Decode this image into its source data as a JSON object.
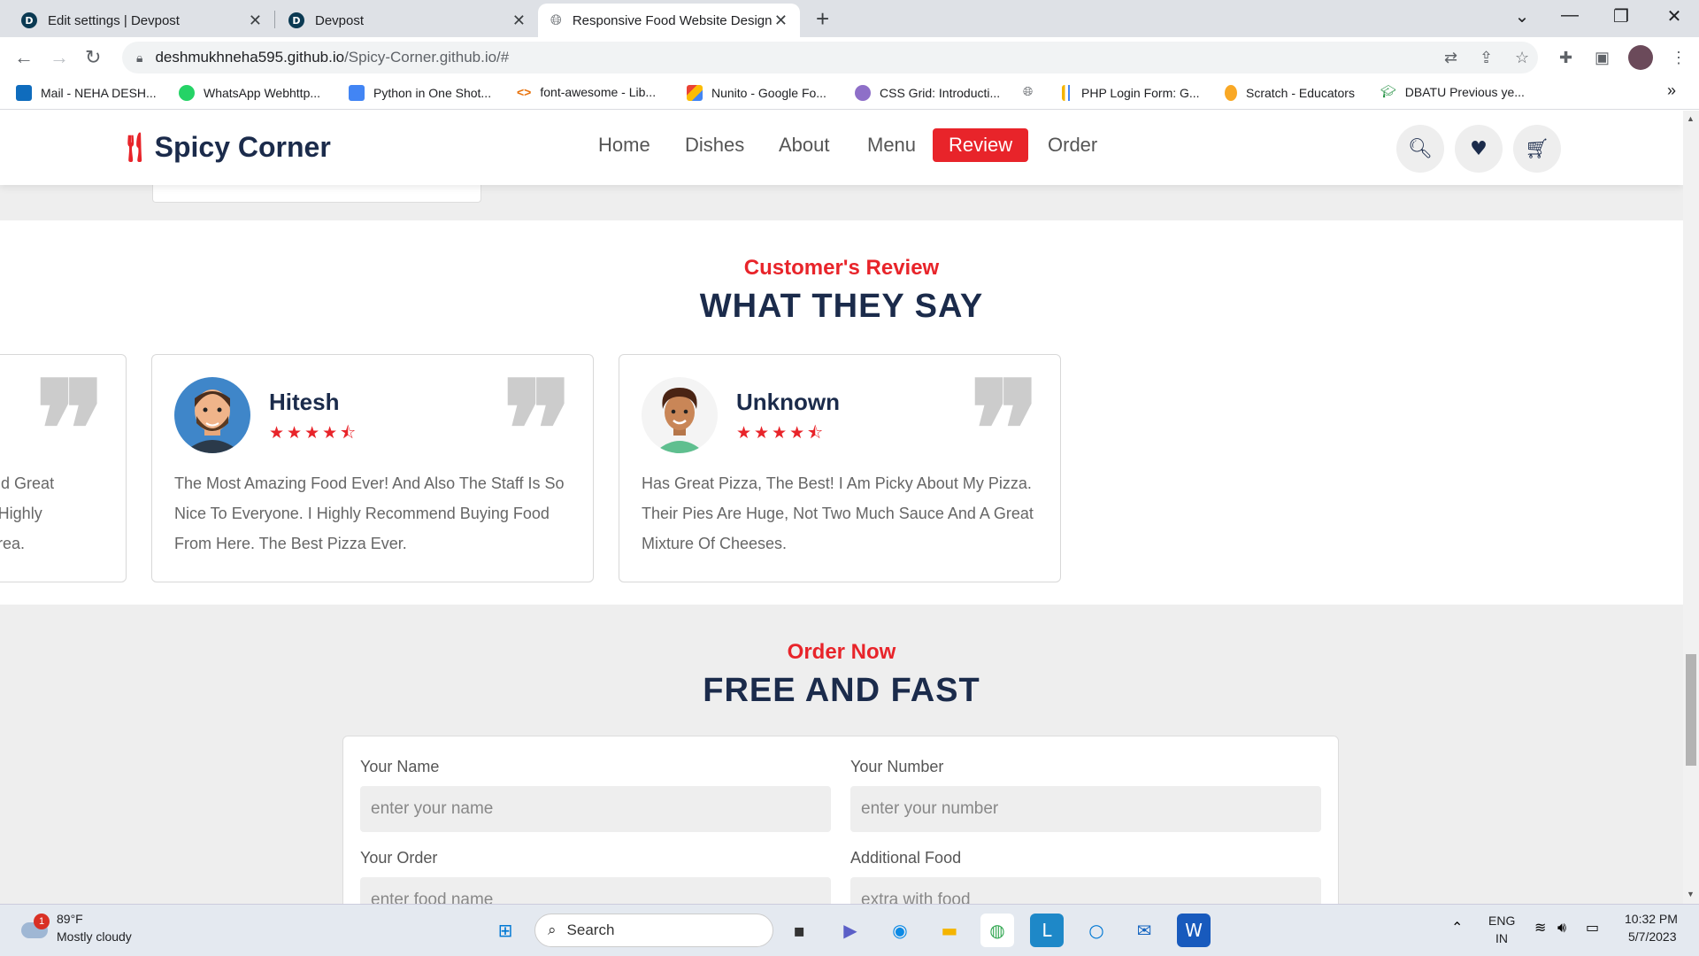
{
  "browser": {
    "tabs": [
      {
        "title": "Edit settings | Devpost",
        "favicon": "D",
        "active": false
      },
      {
        "title": "Devpost",
        "favicon": "D",
        "active": false
      },
      {
        "title": "Responsive Food Website Design",
        "favicon": "globe",
        "active": true
      }
    ],
    "new_tab": "+",
    "url_host": "deshmukhneha595.github.io",
    "url_path": "/Spicy-Corner.github.io/#",
    "bookmarks": [
      "Mail - NEHA DESH...",
      "WhatsApp Webhttp...",
      "Python in One Shot...",
      "font-awesome - Lib...",
      "Nunito - Google Fo...",
      "CSS Grid: Introducti...",
      "PHP Login Form: G...",
      "Scratch - Educators",
      "DBATU Previous ye..."
    ],
    "more_bookmarks": "»"
  },
  "site": {
    "logo": "Spicy Corner",
    "nav": [
      "Home",
      "Dishes",
      "About",
      "Menu",
      "Review",
      "Order"
    ],
    "active_nav": "Review",
    "accent_color": "#e8242a",
    "heading_color": "#1b2b4b"
  },
  "review": {
    "subheading": "Customer's Review",
    "heading": "WHAT THEY SAY",
    "partial_card_lines": [
      "ns And Great",
      "dly. I Highly",
      "eet Area."
    ],
    "cards": [
      {
        "name": "Hitesh",
        "rating": 4.5,
        "text": "The Most Amazing Food Ever! And Also The Staff Is So Nice To Everyone. I Highly Recommend Buying Food From Here. The Best Pizza Ever."
      },
      {
        "name": "Unknown",
        "rating": 4.5,
        "text": "Has Great Pizza, The Best! I Am Picky About My Pizza. Their Pies Are Huge, Not Two Much Sauce And A Great Mixture Of Cheeses."
      }
    ]
  },
  "order": {
    "subheading": "Order Now",
    "heading": "FREE AND FAST",
    "fields": [
      {
        "label": "Your Name",
        "placeholder": "enter your name"
      },
      {
        "label": "Your Number",
        "placeholder": "enter your number"
      },
      {
        "label": "Your Order",
        "placeholder": "enter food name"
      },
      {
        "label": "Additional Food",
        "placeholder": "extra with food"
      }
    ]
  },
  "taskbar": {
    "weather_temp": "89°F",
    "weather_desc": "Mostly cloudy",
    "weather_badge": "1",
    "search_label": "Search",
    "lang_top": "ENG",
    "lang_bottom": "IN",
    "time": "10:32 PM",
    "date": "5/7/2023"
  }
}
